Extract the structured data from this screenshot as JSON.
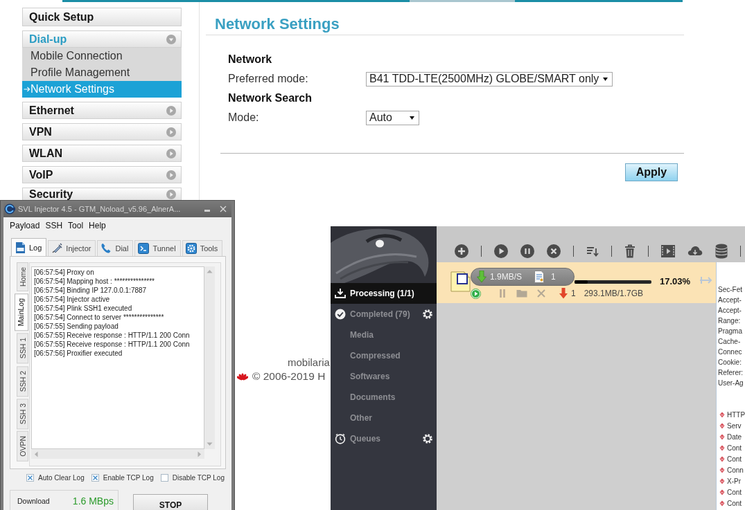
{
  "router": {
    "menu": [
      {
        "label": "Quick Setup",
        "kind": "item"
      },
      {
        "label": "Dial-up",
        "kind": "group",
        "expanded": true,
        "children": [
          {
            "label": "Mobile Connection",
            "selected": false
          },
          {
            "label": "Profile Management",
            "selected": false
          },
          {
            "label": "Network Settings",
            "selected": true
          }
        ]
      },
      {
        "label": "Ethernet",
        "kind": "group",
        "expanded": false
      },
      {
        "label": "VPN",
        "kind": "group",
        "expanded": false
      },
      {
        "label": "WLAN",
        "kind": "group",
        "expanded": false
      },
      {
        "label": "VoIP",
        "kind": "group",
        "expanded": false
      },
      {
        "label": "Security",
        "kind": "group",
        "expanded": false
      }
    ],
    "title": "Network Settings",
    "sections": [
      {
        "heading": "Network",
        "fields": [
          {
            "label": "Preferred mode:",
            "value": "B41 TDD-LTE(2500MHz) GLOBE/SMART only"
          }
        ]
      },
      {
        "heading": "Network Search",
        "fields": [
          {
            "label": "Mode:",
            "value": "Auto"
          }
        ]
      }
    ],
    "apply_button": "Apply",
    "footer": {
      "line_1": "mobilaria",
      "line_2": "© 2006-2019 H"
    }
  },
  "injector": {
    "title": "SVL Injector 4.5 - GTM_Noload_v5.96_AlnerA...",
    "menu": [
      "Payload",
      "SSH",
      "Tool",
      "Help"
    ],
    "tabs": [
      {
        "label": "Log",
        "selected": true
      },
      {
        "label": "Injector",
        "selected": false
      },
      {
        "label": "Dial",
        "selected": false
      },
      {
        "label": "Tunnel",
        "selected": false
      },
      {
        "label": "Tools",
        "selected": false
      }
    ],
    "side_tabs": [
      {
        "label": "Home",
        "selected": false
      },
      {
        "label": "MainLog",
        "selected": true
      },
      {
        "label": "SSH 1",
        "selected": false
      },
      {
        "label": "SSH 2",
        "selected": false
      },
      {
        "label": "SSH 3",
        "selected": false
      },
      {
        "label": "OVPN",
        "selected": false
      }
    ],
    "log": [
      "[06:57:54] Proxy on",
      "[06:57:54] Mapping host : ***************",
      "[06:57:54] Binding IP 127.0.0.1:7887",
      "[06:57:54] Injector active",
      "[06:57:54] Plink SSH1 executed",
      "[06:57:54] Connect to server ***************",
      "[06:57:55] Sending payload",
      "[06:57:55] Receive response : HTTP/1.1 200 Conn",
      "[06:57:55] Receive response : HTTP/1.1 200 Conn",
      "[06:57:56] Proxifier executed"
    ],
    "options": [
      {
        "label": "Auto Clear Log",
        "checked": true
      },
      {
        "label": "Enable TCP Log",
        "checked": true
      },
      {
        "label": "Disable TCP Log",
        "checked": false
      }
    ],
    "download": {
      "label": "Download",
      "reading": "1.6 MBps"
    },
    "stop_button": "STOP"
  },
  "downloader": {
    "sidebar": [
      {
        "label": "Processing (1/1)",
        "kind": "processing",
        "selected": true
      },
      {
        "label": "Completed (79)",
        "kind": "completed",
        "selected": false
      },
      {
        "label": "Media",
        "kind": "filter",
        "selected": false
      },
      {
        "label": "Compressed",
        "kind": "filter",
        "selected": false
      },
      {
        "label": "Softwares",
        "kind": "filter",
        "selected": false
      },
      {
        "label": "Documents",
        "kind": "filter",
        "selected": false
      },
      {
        "label": "Other",
        "kind": "filter",
        "selected": false
      },
      {
        "label": "Queues",
        "kind": "queues",
        "selected": false
      }
    ],
    "item": {
      "speed": "1.9MB/S",
      "files": "1",
      "level": 0.1703,
      "percent": "17.03%",
      "connections": "1",
      "size": "293.1MB/1.7GB"
    },
    "request_headers": [
      "Sec-Fet",
      "Accept-",
      "Accept-",
      "Range:",
      "Pragma",
      "Cache-",
      "Connec",
      "Cookie:",
      "Referer:",
      "User-Ag"
    ],
    "response_headers": [
      "HTTP",
      "Serv",
      "Date",
      "Cont",
      "Cont",
      "Conn",
      "X-Pr",
      "Cont",
      "Cont"
    ]
  }
}
